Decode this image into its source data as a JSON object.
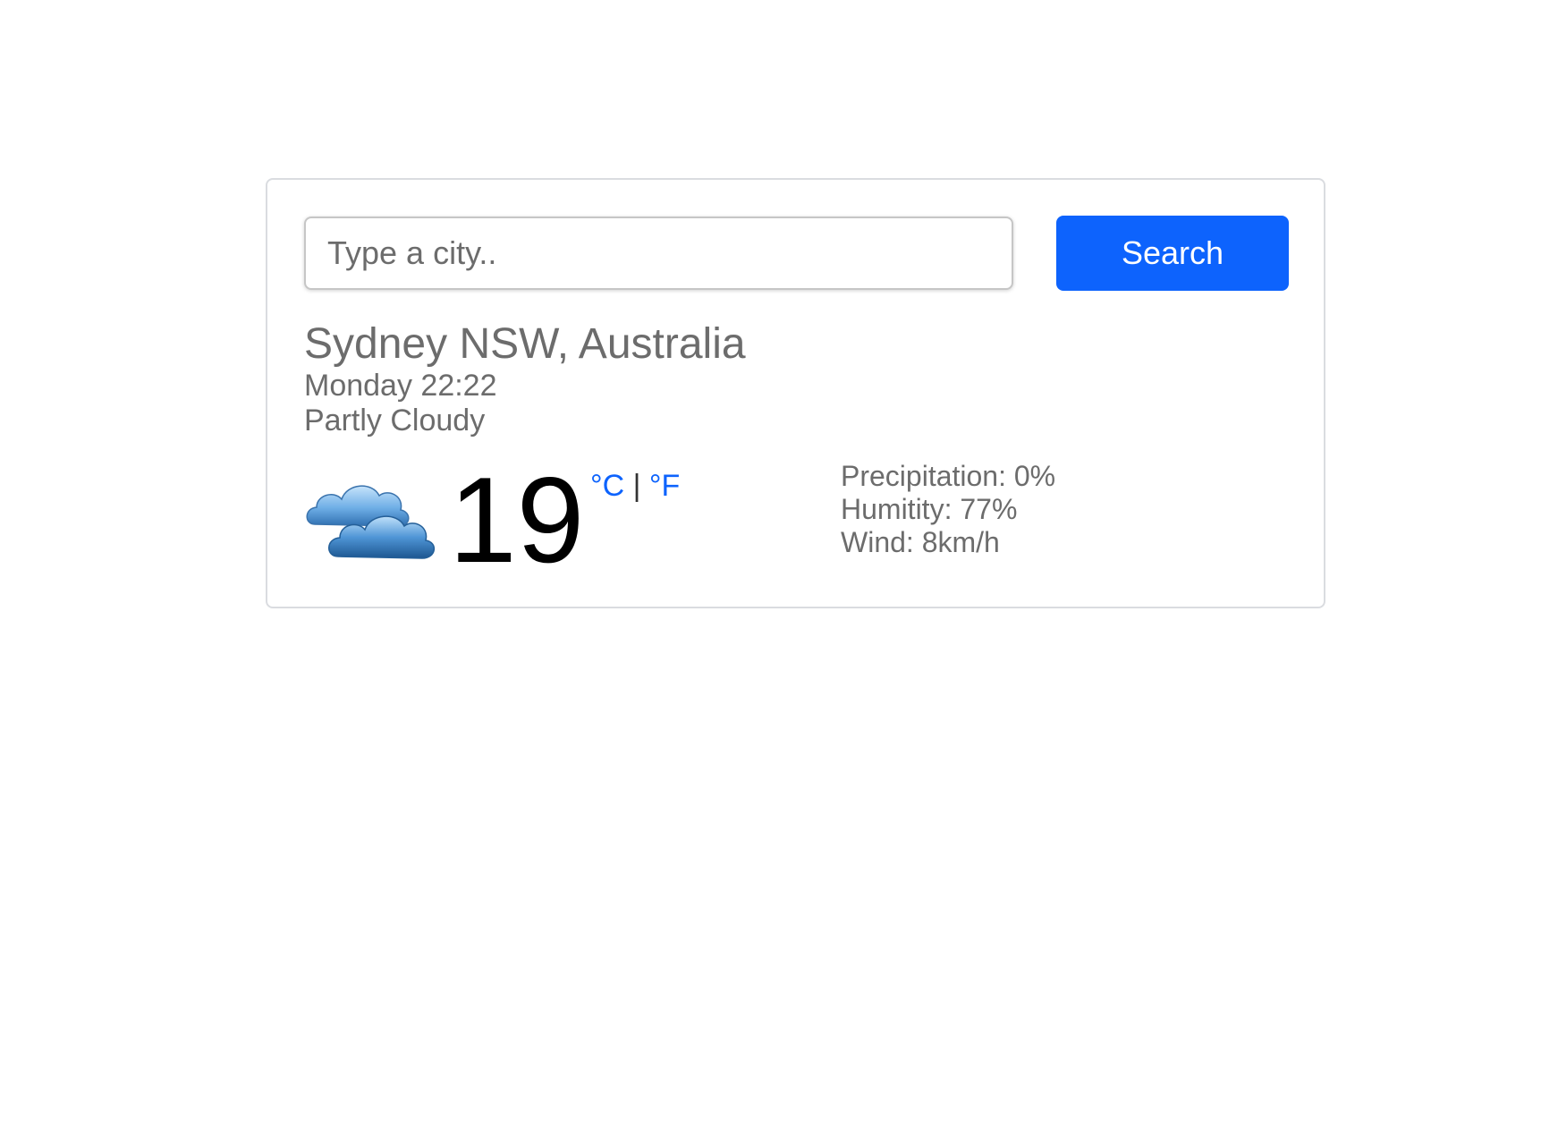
{
  "search": {
    "placeholder": "Type a city..",
    "value": "",
    "button_label": "Search"
  },
  "current": {
    "city": "Sydney NSW, Australia",
    "date_time": "Monday 22:22",
    "description": "Partly Cloudy",
    "icon": "cloud-icon",
    "temperature": "19",
    "unit_celsius": "°C",
    "unit_separator": "|",
    "unit_fahrenheit": "°F"
  },
  "details": {
    "precipitation": "Precipitation: 0%",
    "humidity": "Humitity: 77%",
    "wind": "Wind: 8km/h"
  },
  "colors": {
    "accent": "#0d63fd",
    "text_muted": "#6c6c6c",
    "card_border": "#dadce0"
  }
}
